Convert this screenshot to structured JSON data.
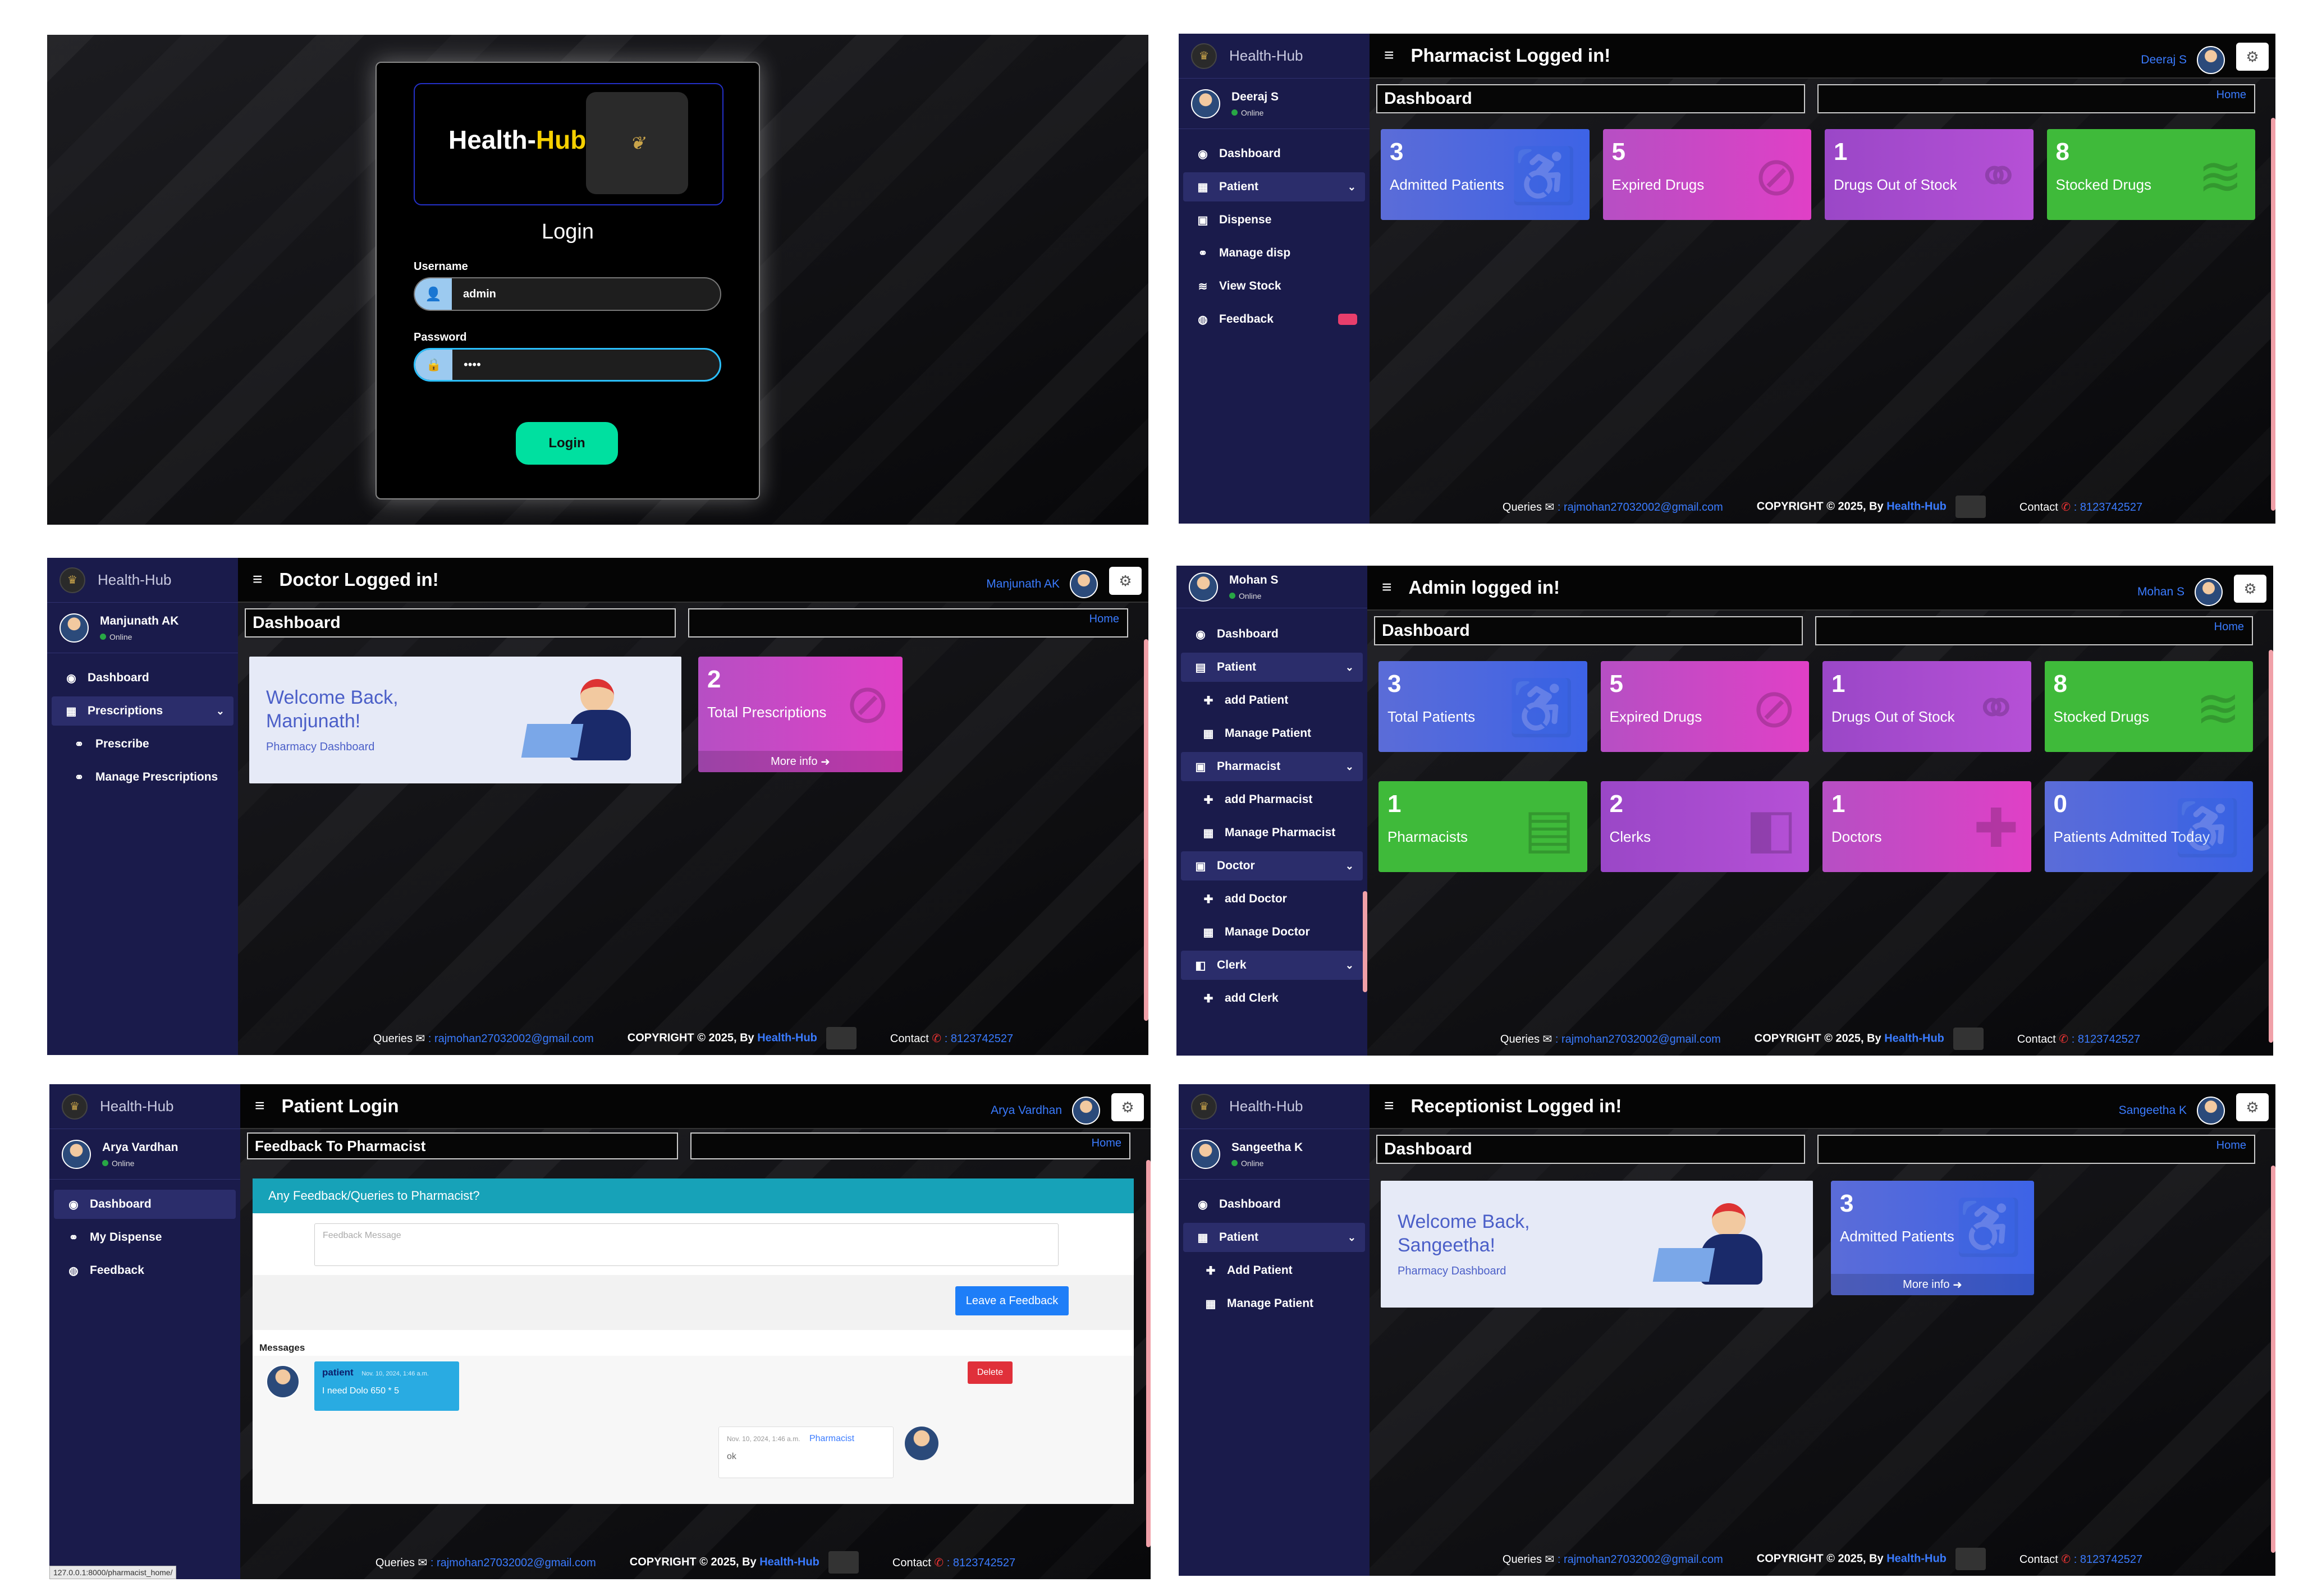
{
  "login": {
    "brand_pre": "Health-",
    "brand_hub": "Hub",
    "title": "Login",
    "username_label": "Username",
    "username_value": "admin",
    "password_label": "Password",
    "password_value": "••••",
    "button": "Login"
  },
  "footer": {
    "queries": "Queries",
    "email": ": rajmohan27032002@gmail.com",
    "copyright": "COPYRIGHT © 2025, By",
    "brand": "Health-Hub",
    "contact": "Contact",
    "phone": ": 8123742527"
  },
  "common": {
    "brand": "Health-Hub",
    "online": "Online",
    "home": "Home",
    "dashboard": "Dashboard",
    "more_info": "More info"
  },
  "pharmacist": {
    "title": "Pharmacist Logged in!",
    "user": "Deeraj S",
    "menu": [
      "Dashboard",
      "Patient",
      "Dispense",
      "Manage disp",
      "View Stock",
      "Feedback"
    ],
    "cards": [
      {
        "num": "3",
        "label": "Admitted Patients"
      },
      {
        "num": "5",
        "label": "Expired Drugs"
      },
      {
        "num": "1",
        "label": "Drugs Out of Stock"
      },
      {
        "num": "8",
        "label": "Stocked Drugs"
      }
    ]
  },
  "doctor": {
    "title": "Doctor Logged in!",
    "user": "Manjunath AK",
    "menu": [
      "Dashboard",
      "Prescriptions",
      "Prescribe",
      "Manage Prescriptions"
    ],
    "welcome": "Welcome Back,",
    "name": "Manjunath!",
    "sub": "Pharmacy Dashboard",
    "card": {
      "num": "2",
      "label": "Total Prescriptions"
    }
  },
  "admin": {
    "title": "Admin logged in!",
    "user": "Mohan S",
    "menu": [
      "Dashboard",
      "Patient",
      "add Patient",
      "Manage Patient",
      "Pharmacist",
      "add Pharmacist",
      "Manage Pharmacist",
      "Doctor",
      "add Doctor",
      "Manage Doctor",
      "Clerk",
      "add Clerk"
    ],
    "cards": [
      {
        "num": "3",
        "label": "Total Patients"
      },
      {
        "num": "5",
        "label": "Expired Drugs"
      },
      {
        "num": "1",
        "label": "Drugs Out of Stock"
      },
      {
        "num": "8",
        "label": "Stocked Drugs"
      },
      {
        "num": "1",
        "label": "Pharmacists"
      },
      {
        "num": "2",
        "label": "Clerks"
      },
      {
        "num": "1",
        "label": "Doctors"
      },
      {
        "num": "0",
        "label": "Patients Admitted Today"
      }
    ]
  },
  "patient": {
    "title": "Patient Login",
    "user": "Arya Vardhan",
    "breadcrumb": "Feedback To Pharmacist",
    "menu": [
      "Dashboard",
      "My Dispense",
      "Feedback"
    ],
    "form_header": "Any Feedback/Queries to Pharmacist?",
    "placeholder": "Feedback Message",
    "submit": "Leave a Feedback",
    "messages_label": "Messages",
    "msg1": {
      "sender": "patient",
      "time": "Nov. 10, 2024, 1:46 a.m.",
      "text": "I need Dolo 650 * 5"
    },
    "delete": "Delete",
    "msg2": {
      "sender": "Pharmacist",
      "time": "Nov. 10, 2024, 1:46 a.m.",
      "text": "ok"
    },
    "status_url": "127.0.0.1:8000/pharmacist_home/"
  },
  "receptionist": {
    "title": "Receptionist Logged in!",
    "user": "Sangeetha K",
    "menu": [
      "Dashboard",
      "Patient",
      "Add Patient",
      "Manage Patient"
    ],
    "welcome": "Welcome Back,",
    "name": "Sangeetha!",
    "sub": "Pharmacy Dashboard",
    "card": {
      "num": "3",
      "label": "Admitted Patients"
    }
  },
  "colors": {
    "sidebar": "#1a1b4b",
    "accent": "#3a7bff",
    "login_button": "#00e0a0",
    "card_blue": "#3d63e6",
    "card_pink": "#e040c6",
    "card_purple": "#b650d6",
    "card_green": "#3fba3a"
  }
}
